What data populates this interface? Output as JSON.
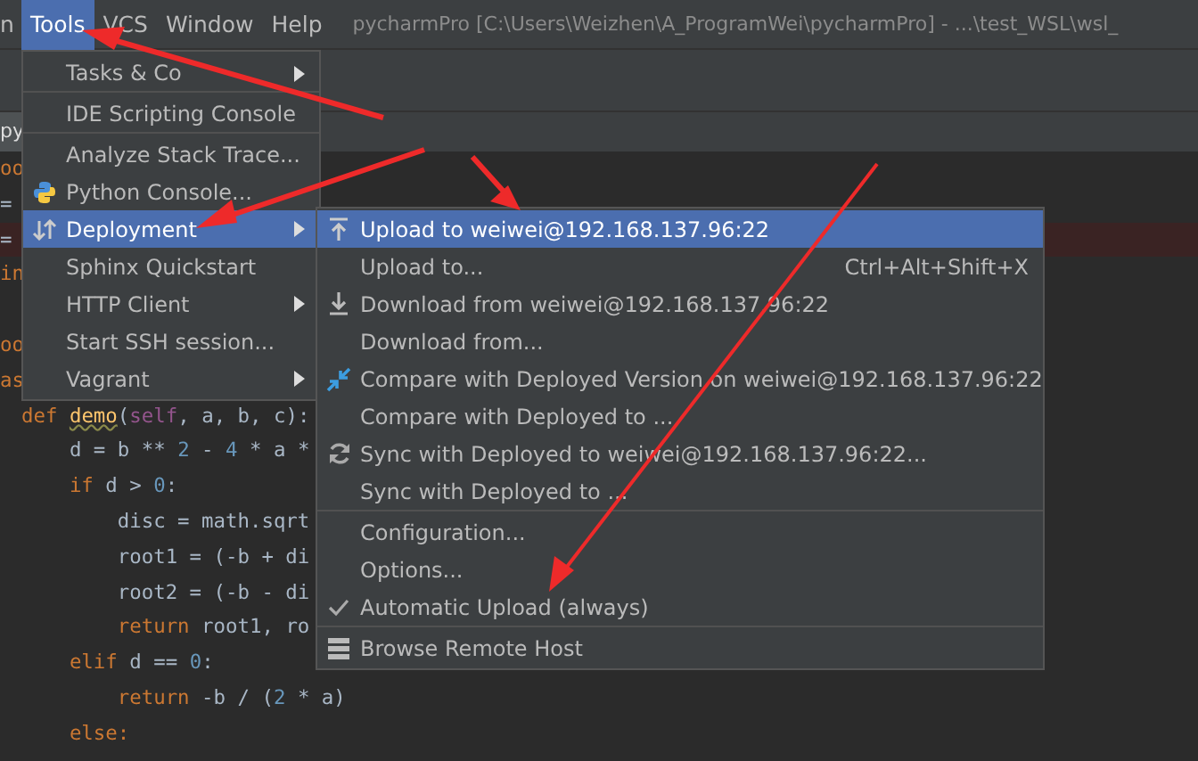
{
  "menubar": {
    "items": [
      {
        "label": "n",
        "selected": false
      },
      {
        "label": "Tools",
        "selected": true
      },
      {
        "label": "VCS",
        "selected": false
      },
      {
        "label": "Window",
        "selected": false
      },
      {
        "label": "Help",
        "selected": false
      }
    ],
    "title": "pycharmPro [C:\\Users\\Weizhen\\A_ProgramWei\\pycharmPro] - ...\\test_WSL\\wsl_"
  },
  "editor_tab": "py",
  "editor_lines": [
    {
      "kind": "fragment",
      "highlighted": false,
      "tokens": [
        {
          "t": "oo",
          "kind": "kw"
        }
      ]
    },
    {
      "kind": "fragment",
      "highlighted": false,
      "tokens": [
        {
          "t": "=",
          "kind": "text"
        }
      ]
    },
    {
      "kind": "fragment",
      "highlighted": true,
      "tokens": [
        {
          "t": "=",
          "kind": "text"
        }
      ]
    },
    {
      "kind": "fragment",
      "highlighted": false,
      "tokens": [
        {
          "t": "in",
          "kind": "kw"
        }
      ]
    },
    {
      "kind": "fragment",
      "highlighted": false
    },
    {
      "kind": "fragment",
      "highlighted": false,
      "tokens": [
        {
          "t": "oo",
          "kind": "kw"
        }
      ]
    },
    {
      "kind": "fragment",
      "highlighted": false,
      "tokens": [
        {
          "t": "as",
          "kind": "kw"
        }
      ]
    },
    {
      "kind": "code",
      "highlighted": false,
      "tokens": [
        {
          "t": "def ",
          "kind": "kw"
        },
        {
          "t": "demo",
          "kind": "fn"
        },
        {
          "t": "(",
          "kind": "text"
        },
        {
          "t": "self",
          "kind": "param"
        },
        {
          "t": ", a, b, c):",
          "kind": "text"
        }
      ]
    },
    {
      "kind": "code",
      "highlighted": false,
      "tokens": [
        {
          "t": "    d = b ** ",
          "kind": "text"
        },
        {
          "t": "2",
          "kind": "num"
        },
        {
          "t": " - ",
          "kind": "text"
        },
        {
          "t": "4",
          "kind": "num"
        },
        {
          "t": " * a *",
          "kind": "text"
        }
      ]
    },
    {
      "kind": "code",
      "highlighted": false,
      "tokens": [
        {
          "t": "    if ",
          "kind": "kw"
        },
        {
          "t": "d > ",
          "kind": "text"
        },
        {
          "t": "0",
          "kind": "num"
        },
        {
          "t": ":",
          "kind": "text"
        }
      ]
    },
    {
      "kind": "code",
      "highlighted": false,
      "tokens": [
        {
          "t": "        disc = math.sqrt",
          "kind": "text"
        }
      ]
    },
    {
      "kind": "code",
      "highlighted": false,
      "tokens": [
        {
          "t": "        root1 = (-b + di",
          "kind": "text"
        }
      ]
    },
    {
      "kind": "code",
      "highlighted": false,
      "tokens": [
        {
          "t": "        root2 = (-b - di",
          "kind": "text"
        }
      ]
    },
    {
      "kind": "code",
      "highlighted": false,
      "tokens": [
        {
          "t": "        return ",
          "kind": "kw"
        },
        {
          "t": "root1, ro",
          "kind": "text"
        }
      ]
    },
    {
      "kind": "code",
      "highlighted": false,
      "tokens": [
        {
          "t": "    elif ",
          "kind": "kw"
        },
        {
          "t": "d == ",
          "kind": "text"
        },
        {
          "t": "0",
          "kind": "num"
        },
        {
          "t": ":",
          "kind": "text"
        }
      ]
    },
    {
      "kind": "code",
      "highlighted": false,
      "tokens": [
        {
          "t": "        return ",
          "kind": "kw"
        },
        {
          "t": "-b / (",
          "kind": "text"
        },
        {
          "t": "2",
          "kind": "num"
        },
        {
          "t": " * a)",
          "kind": "text"
        }
      ]
    },
    {
      "kind": "code",
      "highlighted": false,
      "tokens": [
        {
          "t": "    else:",
          "kind": "kw"
        }
      ]
    }
  ],
  "tools_menu": [
    {
      "label": "Tasks & Co",
      "kind": "plain",
      "submenu": true,
      "selected": false,
      "separator_after": true
    },
    {
      "label": "IDE Scripting Console",
      "kind": "plain",
      "submenu": false,
      "selected": false,
      "separator_after": true
    },
    {
      "label": "Analyze Stack Trace...",
      "kind": "plain",
      "submenu": false,
      "selected": false,
      "separator_after": false
    },
    {
      "label": "Python Console...",
      "kind": "python",
      "submenu": false,
      "selected": false,
      "separator_after": false
    },
    {
      "label": "Deployment",
      "kind": "deploy",
      "submenu": true,
      "selected": true,
      "separator_after": false
    },
    {
      "label": "Sphinx Quickstart",
      "kind": "plain",
      "submenu": false,
      "selected": false,
      "separator_after": false
    },
    {
      "label": "HTTP Client",
      "kind": "plain",
      "submenu": true,
      "selected": false,
      "separator_after": false
    },
    {
      "label": "Start SSH session...",
      "kind": "plain",
      "submenu": false,
      "selected": false,
      "separator_after": false
    },
    {
      "label": "Vagrant",
      "kind": "plain",
      "submenu": true,
      "selected": false,
      "separator_after": false
    }
  ],
  "deployment_menu": [
    {
      "label": "Upload to weiwei@192.168.137.96:22",
      "kind": "upload",
      "selected": true,
      "checked": false,
      "separator_after": false
    },
    {
      "label": "Upload to...",
      "shortcut": "Ctrl+Alt+Shift+X",
      "selected": false,
      "checked": false,
      "separator_after": false
    },
    {
      "label": "Download from weiwei@192.168.137.96:22",
      "kind": "download",
      "selected": false,
      "checked": false,
      "separator_after": false
    },
    {
      "label": "Download from...",
      "selected": false,
      "checked": false,
      "separator_after": false
    },
    {
      "label": "Compare with Deployed Version on weiwei@192.168.137.96:22",
      "kind": "compare",
      "selected": false,
      "checked": false,
      "separator_after": false
    },
    {
      "label": "Compare with Deployed to ...",
      "selected": false,
      "checked": false,
      "separator_after": false
    },
    {
      "label": "Sync with Deployed to weiwei@192.168.137.96:22...",
      "kind": "sync",
      "selected": false,
      "checked": false,
      "separator_after": false
    },
    {
      "label": "Sync with Deployed to ...",
      "selected": false,
      "checked": false,
      "separator_after": true
    },
    {
      "label": "Configuration...",
      "selected": false,
      "checked": false,
      "separator_after": false
    },
    {
      "label": "Options...",
      "selected": false,
      "checked": false,
      "separator_after": false
    },
    {
      "label": "Automatic Upload (always)",
      "selected": false,
      "checked": true,
      "separator_after": true
    },
    {
      "label": "Browse Remote Host",
      "kind": "server",
      "selected": false,
      "checked": false,
      "separator_after": false
    }
  ]
}
